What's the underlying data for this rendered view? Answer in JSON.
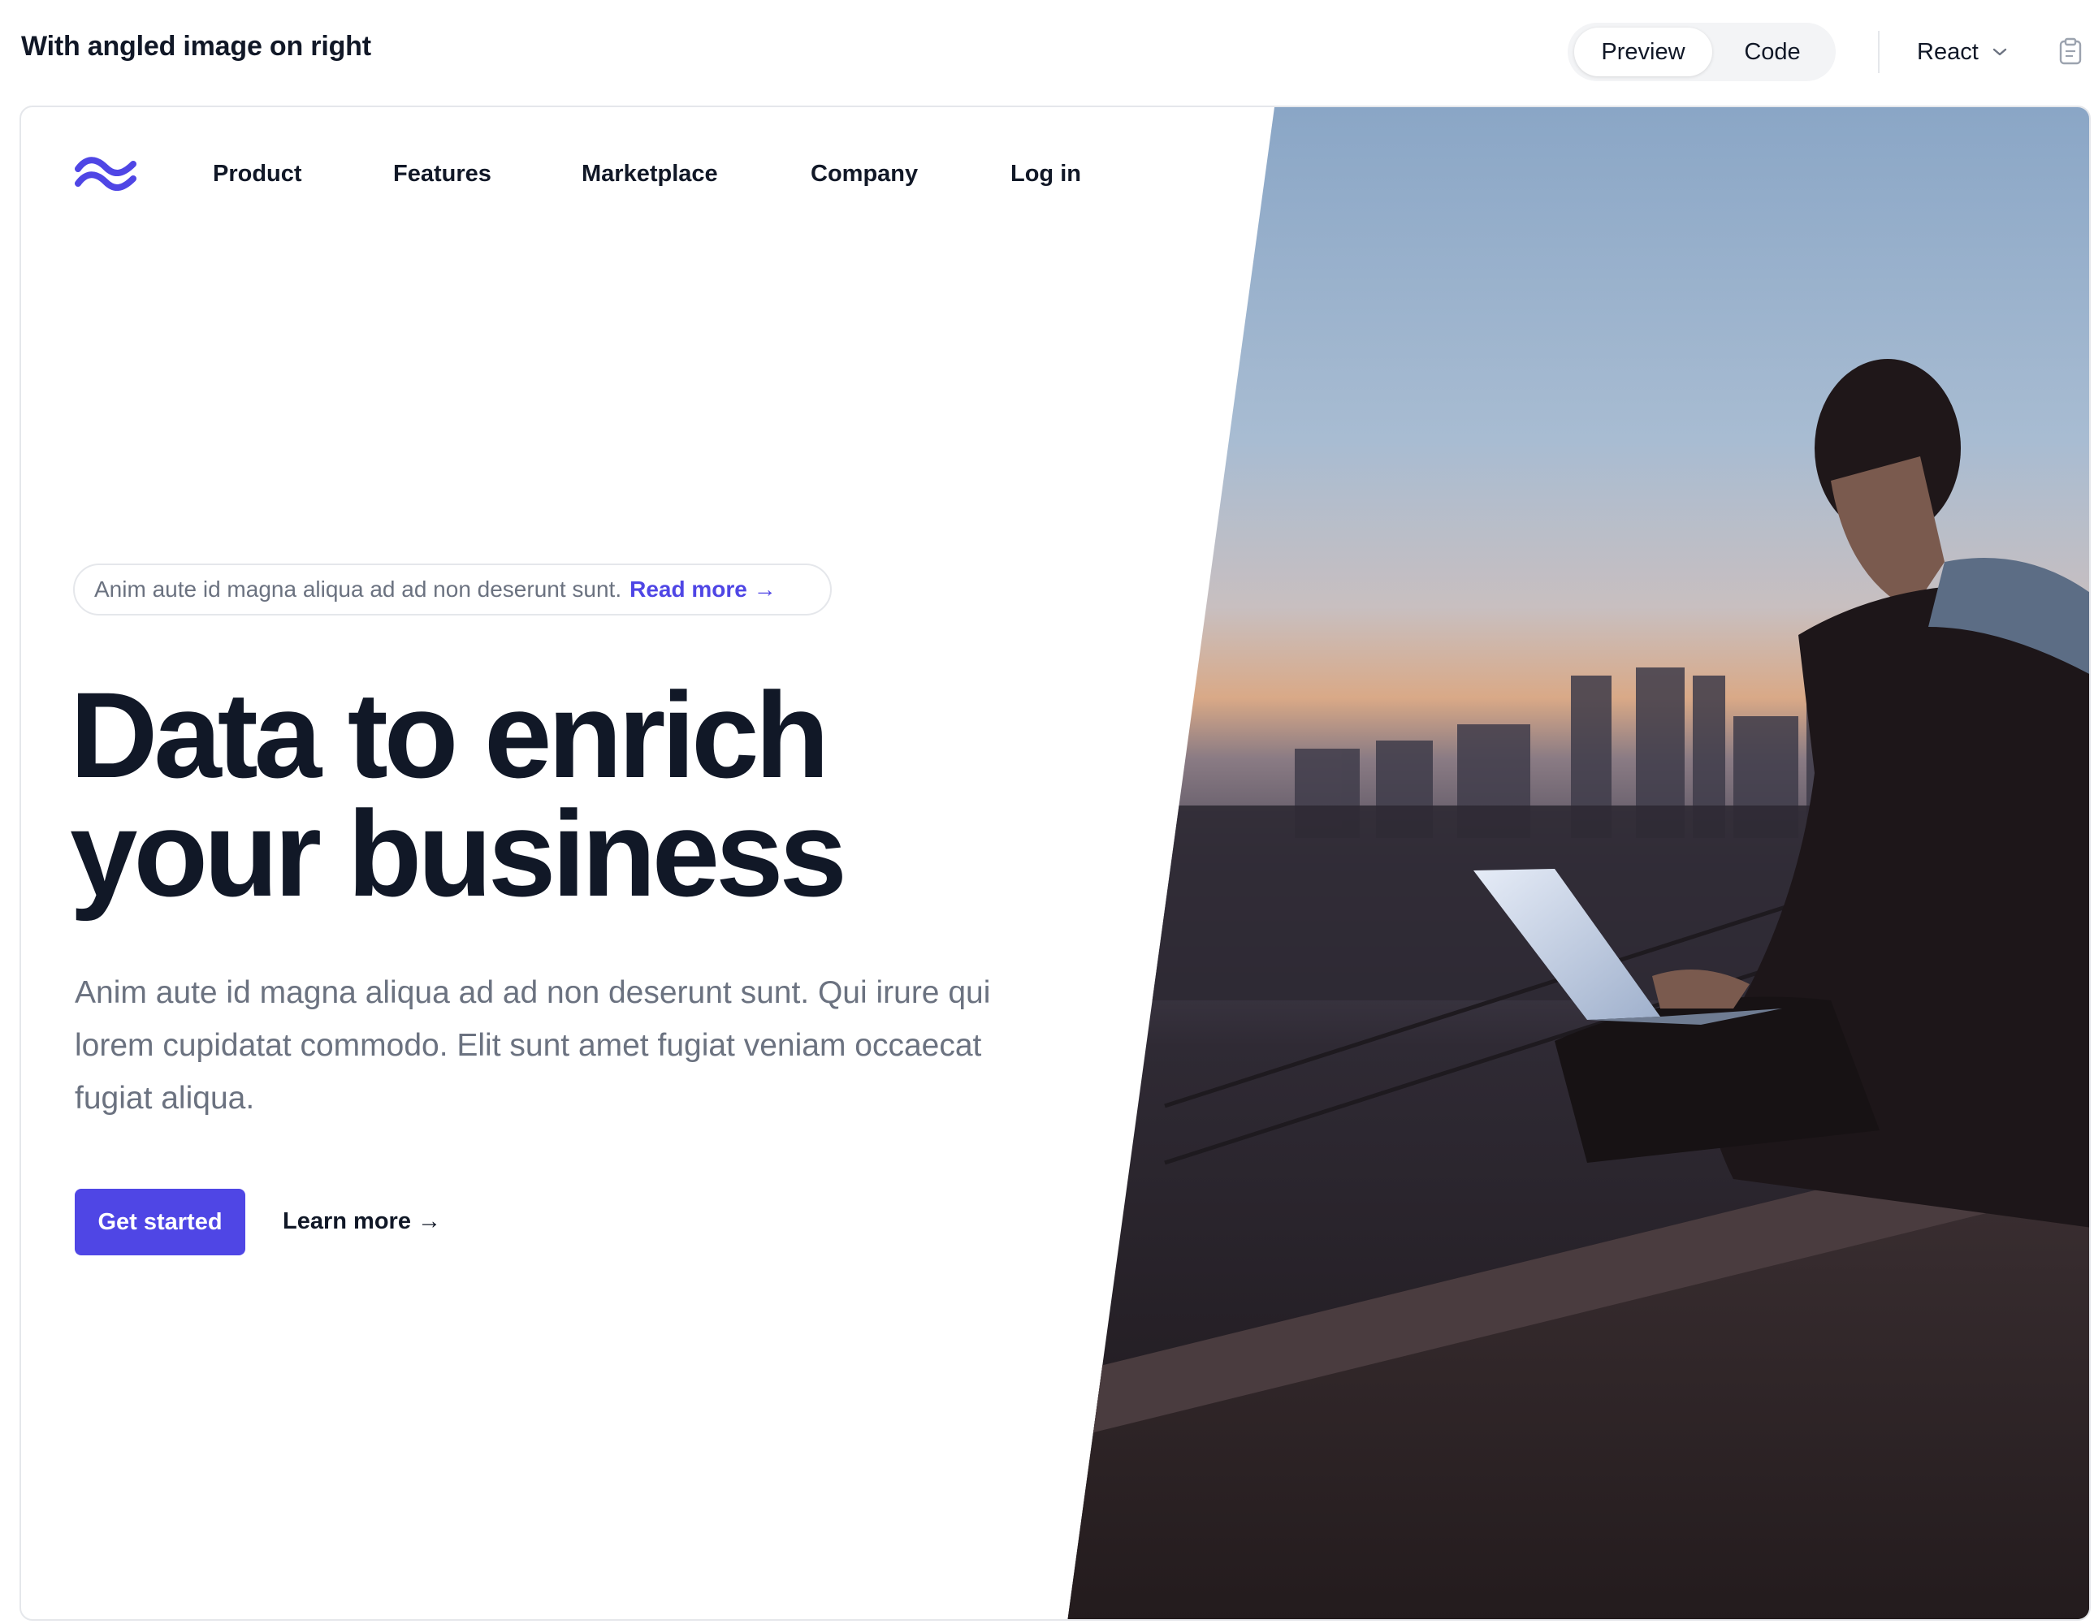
{
  "toolbar": {
    "title": "With angled image on right",
    "tabs": [
      {
        "label": "Preview",
        "active": true
      },
      {
        "label": "Code",
        "active": false
      }
    ],
    "framework": "React",
    "icons": [
      "chevron-down-icon",
      "clipboard-icon"
    ]
  },
  "hero": {
    "logo_icon": "tailwind-wave-logo",
    "nav": [
      "Product",
      "Features",
      "Marketplace",
      "Company",
      "Log in"
    ],
    "announcement": {
      "text": "Anim aute id magna aliqua ad ad non deserunt sunt.",
      "link": "Read more →"
    },
    "headline_line1": "Data to enrich",
    "headline_line2": "your business",
    "lead": "Anim aute id magna aliqua ad ad non deserunt sunt. Qui irure qui lorem cupidatat commodo. Elit sunt amet fugiat veniam occaecat fugiat aliqua.",
    "primary_cta": "Get started",
    "secondary_cta": "Learn more →",
    "image_alt": "Man working on a laptop on a rooftop at dusk overlooking a city"
  },
  "colors": {
    "accent": "#4f46e5",
    "text": "#111827",
    "muted": "#6b7280",
    "border": "#e5e7eb"
  }
}
